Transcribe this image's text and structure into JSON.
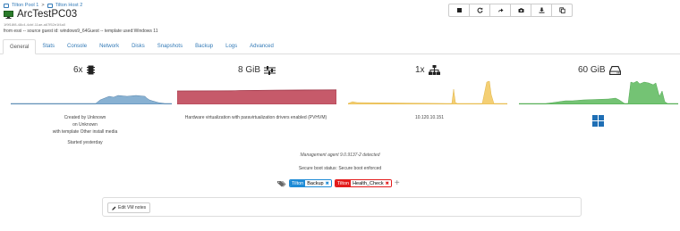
{
  "breadcrumb": {
    "pool": "Tilton Pool 1",
    "separator": ">",
    "host": "Tilton Host 2"
  },
  "vm": {
    "title": "ArcTestPC03",
    "uuid": "1f9f18f8-48c4-4cbf-11ae-a67f52e1f4a0",
    "subline": "from esxi -- source guest id: windows9_64Guest -- template used:Windows 11"
  },
  "toolbar": {
    "buttons": [
      "stop",
      "restart",
      "migrate",
      "snapshot",
      "export",
      "copy"
    ]
  },
  "tabs": [
    "General",
    "Stats",
    "Console",
    "Network",
    "Disks",
    "Snapshots",
    "Backup",
    "Logs",
    "Advanced"
  ],
  "active_tab": "General",
  "stats": {
    "cpu": "6x",
    "memory": "8 GiB",
    "network": "1x",
    "disk": "60 GiB"
  },
  "colors": {
    "cpu": "#6a9ec7",
    "memory": "#c0485a",
    "network": "#f2c75c",
    "disk": "#5cb85c",
    "link": "#337ab7"
  },
  "info": {
    "created_by": "Created by Unknown",
    "created_on": "on Unknown",
    "template": "with template Other install media",
    "started": "Started yesterday",
    "virtualization": "Hardware virtualization with paravirtualization drivers enabled (PVHVM)",
    "ip": "10.120.10.151",
    "os_icon": "windows-icon"
  },
  "management_agent": "Management agent 9.0.9137-2 detected",
  "secure_boot": "Secure boot status: Secure boot enforced",
  "tags": [
    {
      "scope": "Tilton",
      "value": "Backup",
      "color": "#1e8bd6"
    },
    {
      "scope": "Tilton",
      "value": "Health_Check",
      "color": "#e31b1b"
    }
  ],
  "notes_button": "Edit VM notes"
}
